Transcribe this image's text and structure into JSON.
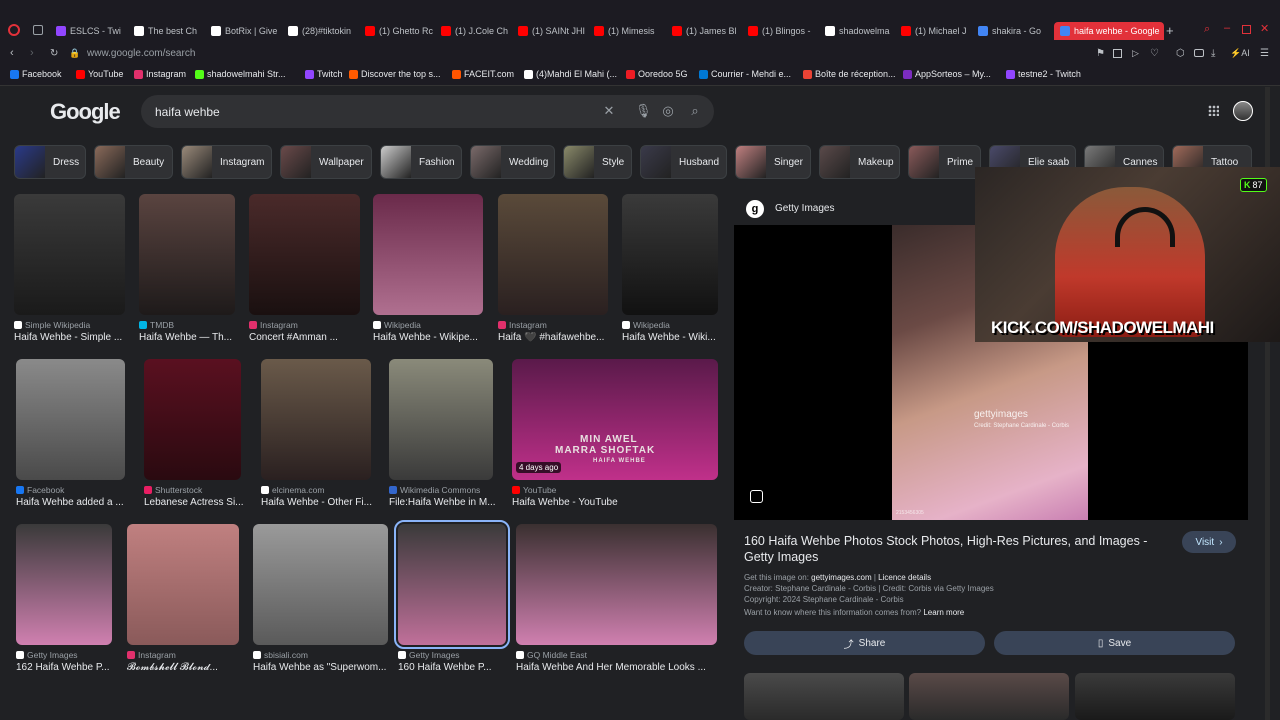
{
  "browser": {
    "tabs": [
      {
        "label": "ESLCS - Twi",
        "color": "#9146ff"
      },
      {
        "label": "The best Ch",
        "color": "#ffffff"
      },
      {
        "label": "BotRix | Give",
        "color": "#ffffff"
      },
      {
        "label": "(28)#tiktokin",
        "color": "#ffffff"
      },
      {
        "label": "(1) Ghetto Rc",
        "color": "#ff0000"
      },
      {
        "label": "(1) J.Cole Ch",
        "color": "#ff0000"
      },
      {
        "label": "(1) SAINt JHI",
        "color": "#ff0000"
      },
      {
        "label": "(1) Mimesis",
        "color": "#ff0000"
      },
      {
        "label": "(1) James Bl",
        "color": "#ff0000"
      },
      {
        "label": "(1) Blingos -",
        "color": "#ff0000"
      },
      {
        "label": "shadowelma",
        "color": "#ffffff"
      },
      {
        "label": "(1) Michael J",
        "color": "#ff0000"
      },
      {
        "label": "shakira - Go",
        "color": "#4285f4"
      },
      {
        "label": "haifa wehbe - Google",
        "color": "#4285f4"
      }
    ],
    "url": "www.google.com/search",
    "bookmarks": [
      {
        "label": "Facebook",
        "color": "#1877f2"
      },
      {
        "label": "YouTube",
        "color": "#ff0000"
      },
      {
        "label": "Instagram",
        "color": "#e1306c"
      },
      {
        "label": "shadowelmahi Str...",
        "color": "#53fc18"
      },
      {
        "label": "Twitch",
        "color": "#9146ff"
      },
      {
        "label": "Discover the top s...",
        "color": "#ff5a00"
      },
      {
        "label": "FACEIT.com",
        "color": "#ff5500"
      },
      {
        "label": "(4)Mahdi El Mahi (...",
        "color": "#ffffff"
      },
      {
        "label": "Ooredoo 5G",
        "color": "#ed1c24"
      },
      {
        "label": "Courrier - Mehdi e...",
        "color": "#0078d4"
      },
      {
        "label": "Boîte de réception...",
        "color": "#ea4335"
      },
      {
        "label": "AppSorteos – My...",
        "color": "#7b2cbf"
      },
      {
        "label": "testne2 - Twitch",
        "color": "#9146ff"
      }
    ]
  },
  "search": {
    "logo": "Google",
    "query": "haifa wehbe"
  },
  "chips": [
    "Dress",
    "Beauty",
    "Instagram",
    "Wallpaper",
    "Fashion",
    "Wedding",
    "Style",
    "Husband",
    "Singer",
    "Makeup",
    "Prime",
    "Elie saab",
    "Cannes",
    "Tattoo"
  ],
  "results": [
    {
      "source": "Simple Wikipedia",
      "title": "Haifa Wehbe - Simple ...",
      "fav": "#ffffff"
    },
    {
      "source": "TMDB",
      "title": "Haifa Wehbe — Th...",
      "fav": "#01b4e4"
    },
    {
      "source": "Instagram",
      "title": "Concert #Amman ...",
      "fav": "#e1306c"
    },
    {
      "source": "Wikipedia",
      "title": "Haifa Wehbe - Wikipe...",
      "fav": "#ffffff"
    },
    {
      "source": "Instagram",
      "title": "Haifa 🖤 #haifawehbe...",
      "fav": "#e1306c"
    },
    {
      "source": "Wikipedia",
      "title": "Haifa Wehbe - Wiki...",
      "fav": "#ffffff"
    },
    {
      "source": "Facebook",
      "title": "Haifa Wehbe added a ...",
      "fav": "#1877f2"
    },
    {
      "source": "Shutterstock",
      "title": "Lebanese Actress Si...",
      "fav": "#e91e63"
    },
    {
      "source": "elcinema.com",
      "title": "Haifa Wehbe - Other Fi...",
      "fav": "#ffffff"
    },
    {
      "source": "Wikimedia Commons",
      "title": "File:Haifa Wehbe in M...",
      "fav": "#3366cc"
    },
    {
      "source": "YouTube",
      "title": "Haifa Wehbe - YouTube",
      "fav": "#ff0000"
    },
    {
      "source": "Getty Images",
      "title": "162 Haifa Wehbe P...",
      "fav": "#ffffff"
    },
    {
      "source": "Instagram",
      "title": "𝓑𝓸𝓶𝓫𝓼𝓱𝓮𝓵𝓵 𝓑𝓵𝓸𝓷𝓭...",
      "fav": "#e1306c"
    },
    {
      "source": "sbisiali.com",
      "title": "Haifa Wehbe as \"Superwom...",
      "fav": "#ffffff"
    },
    {
      "source": "Getty Images",
      "title": "160 Haifa Wehbe P...",
      "fav": "#ffffff"
    },
    {
      "source": "GQ Middle East",
      "title": "Haifa Wehbe And Her Memorable Looks ...",
      "fav": "#ffffff"
    }
  ],
  "badges": {
    "days_ago": "4 days ago",
    "thumb_caption_1": "MIN AWEL",
    "thumb_caption_2": "MARRA SHOFTAK",
    "thumb_caption_3": "HAIFA WEHBE"
  },
  "preview": {
    "source": "Getty Images",
    "watermark": "gettyimages",
    "watermark_credit": "Credit: Stephane Cardinale - Corbis",
    "image_id": "2153456305",
    "title": "160 Haifa Wehbe Photos Stock Photos, High-Res Pictures, and Images - Getty Images",
    "visit": "Visit",
    "get_this": "Get this image on:",
    "get_this_site": "gettyimages.com",
    "licence": "Licence details",
    "creator": "Creator: Stephane Cardinale - Corbis | Credit: Corbis via Getty Images",
    "copyright": "Copyright: 2024 Stephane Cardinale - Corbis",
    "want": "Want to know where this information comes from?",
    "learn_more": "Learn more",
    "share": "Share",
    "save": "Save"
  },
  "stream": {
    "url_text": "KICK.COM/SHADOWELMAHI",
    "viewers": "87",
    "brand_color": "#53fc18"
  }
}
